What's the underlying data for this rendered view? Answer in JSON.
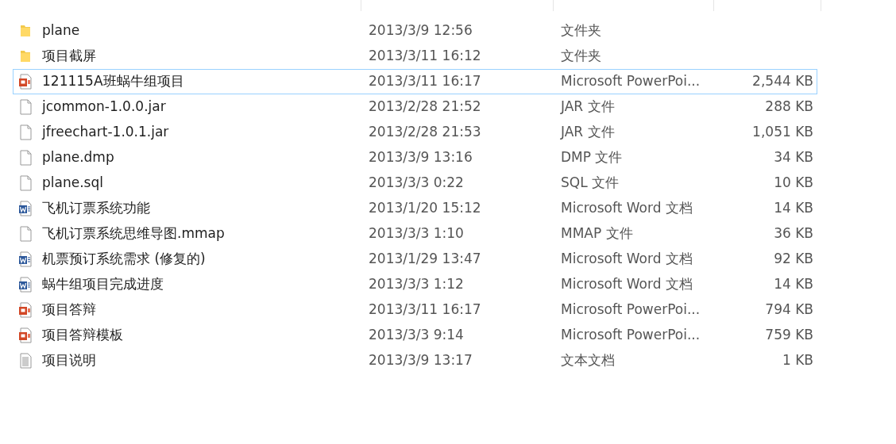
{
  "files": [
    {
      "kind": "folder",
      "name": "plane",
      "modified": "2013/3/9 12:56",
      "type": "文件夹",
      "selected": false
    },
    {
      "kind": "folder",
      "name": "项目截屏",
      "modified": "2013/3/11 16:12",
      "type": "文件夹",
      "selected": false
    },
    {
      "kind": "ppt",
      "name": "121115A班蜗牛组项目",
      "modified": "2013/3/11 16:17",
      "type": "Microsoft PowerPoi...",
      "size": "2,544 KB",
      "selected": true
    },
    {
      "kind": "file",
      "name": "jcommon-1.0.0.jar",
      "modified": "2013/2/28 21:52",
      "type": "JAR 文件",
      "size": "288 KB",
      "selected": false
    },
    {
      "kind": "file",
      "name": "jfreechart-1.0.1.jar",
      "modified": "2013/2/28 21:53",
      "type": "JAR 文件",
      "size": "1,051 KB",
      "selected": false
    },
    {
      "kind": "file",
      "name": "plane.dmp",
      "modified": "2013/3/9 13:16",
      "type": "DMP 文件",
      "size": "34 KB",
      "selected": false
    },
    {
      "kind": "file",
      "name": "plane.sql",
      "modified": "2013/3/3 0:22",
      "type": "SQL 文件",
      "size": "10 KB",
      "selected": false
    },
    {
      "kind": "word",
      "name": "飞机订票系统功能",
      "modified": "2013/1/20 15:12",
      "type": "Microsoft Word 文档",
      "size": "14 KB",
      "selected": false
    },
    {
      "kind": "file",
      "name": "飞机订票系统思维导图.mmap",
      "modified": "2013/3/3 1:10",
      "type": "MMAP 文件",
      "size": "36 KB",
      "selected": false
    },
    {
      "kind": "word",
      "name": "机票预订系统需求 (修复的)",
      "modified": "2013/1/29 13:47",
      "type": "Microsoft Word 文档",
      "size": "92 KB",
      "selected": false
    },
    {
      "kind": "word",
      "name": "蜗牛组项目完成进度",
      "modified": "2013/3/3 1:12",
      "type": "Microsoft Word 文档",
      "size": "14 KB",
      "selected": false
    },
    {
      "kind": "ppt",
      "name": "项目答辩",
      "modified": "2013/3/11 16:17",
      "type": "Microsoft PowerPoi...",
      "size": "794 KB",
      "selected": false
    },
    {
      "kind": "ppt",
      "name": "项目答辩模板",
      "modified": "2013/3/3 9:14",
      "type": "Microsoft PowerPoi...",
      "size": "759 KB",
      "selected": false
    },
    {
      "kind": "text",
      "name": "项目说明",
      "modified": "2013/3/9 13:17",
      "type": "文本文档",
      "size": "1 KB",
      "selected": false
    }
  ]
}
